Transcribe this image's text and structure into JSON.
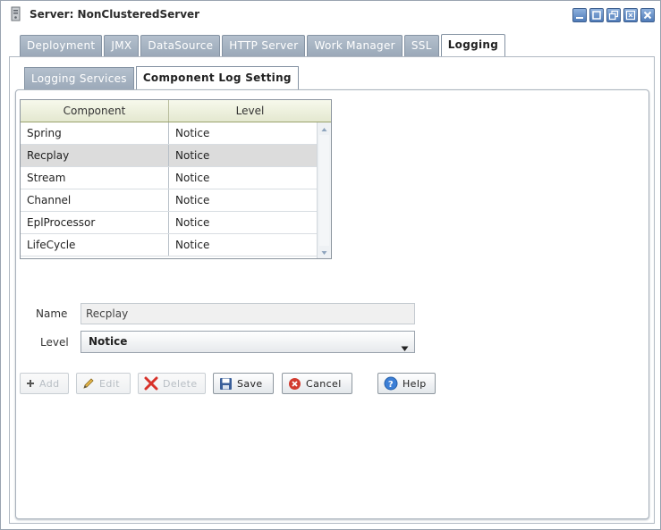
{
  "window": {
    "title": "Server: NonClusteredServer"
  },
  "outer_tabs": [
    {
      "label": "Deployment"
    },
    {
      "label": "JMX"
    },
    {
      "label": "DataSource"
    },
    {
      "label": "HTTP Server"
    },
    {
      "label": "Work Manager"
    },
    {
      "label": "SSL"
    },
    {
      "label": "Logging",
      "active": true
    }
  ],
  "inner_tabs": [
    {
      "label": "Logging Services"
    },
    {
      "label": "Component Log Setting",
      "active": true
    }
  ],
  "table": {
    "columns": [
      "Component",
      "Level"
    ],
    "rows": [
      {
        "component": "Spring",
        "level": "Notice"
      },
      {
        "component": "Recplay",
        "level": "Notice",
        "selected": true
      },
      {
        "component": "Stream",
        "level": "Notice"
      },
      {
        "component": "Channel",
        "level": "Notice"
      },
      {
        "component": "EplProcessor",
        "level": "Notice"
      },
      {
        "component": "LifeCycle",
        "level": "Notice"
      }
    ]
  },
  "form": {
    "name_label": "Name",
    "name_value": "Recplay",
    "level_label": "Level",
    "level_value": "Notice"
  },
  "buttons": {
    "add": "Add",
    "edit": "Edit",
    "delete": "Delete",
    "save": "Save",
    "cancel": "Cancel",
    "help": "Help"
  },
  "icons": {
    "window": "server-icon",
    "window_controls": [
      "minimize-icon",
      "maximize-icon",
      "restore-icon",
      "dock-icon",
      "close-icon"
    ]
  }
}
